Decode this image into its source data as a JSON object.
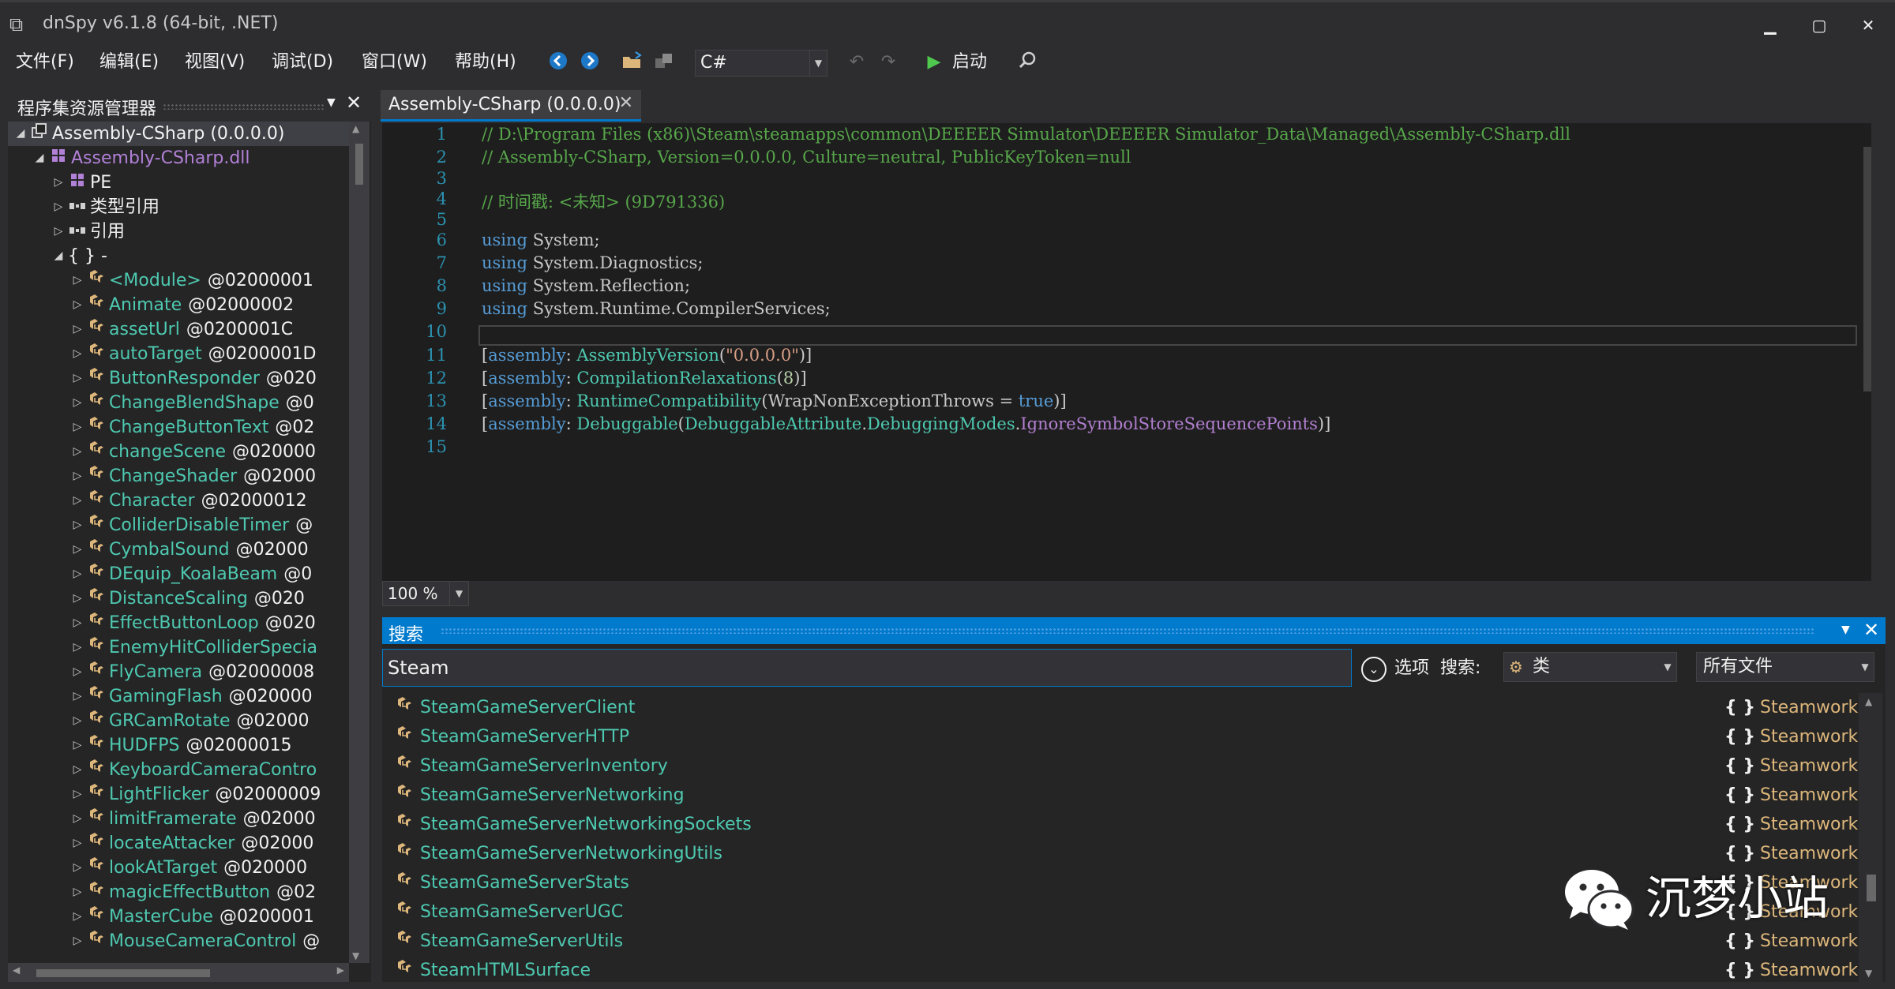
{
  "window": {
    "title": "dnSpy v6.1.8 (64-bit, .NET)",
    "minimize": "▁",
    "maximize": "▢",
    "close": "✕"
  },
  "menu": {
    "items": [
      "文件(F)",
      "编辑(E)",
      "视图(V)",
      "调试(D)",
      "窗口(W)",
      "帮助(H)"
    ]
  },
  "toolbar": {
    "language": "C#",
    "start_label": "启动"
  },
  "explorer": {
    "title": "程序集资源管理器",
    "root": "Assembly-CSharp (0.0.0.0)",
    "module": "Assembly-CSharp.dll",
    "children": [
      "PE",
      "类型引用",
      "引用",
      "{ } -"
    ],
    "types": [
      {
        "name": "<Module>",
        "token": "@02000001"
      },
      {
        "name": "Animate",
        "token": "@02000002"
      },
      {
        "name": "assetUrl",
        "token": "@0200001C"
      },
      {
        "name": "autoTarget",
        "token": "@0200001D"
      },
      {
        "name": "ButtonResponder",
        "token": "@020"
      },
      {
        "name": "ChangeBlendShape",
        "token": "@0"
      },
      {
        "name": "ChangeButtonText",
        "token": "@02"
      },
      {
        "name": "changeScene",
        "token": "@020000"
      },
      {
        "name": "ChangeShader",
        "token": "@02000"
      },
      {
        "name": "Character",
        "token": "@02000012"
      },
      {
        "name": "ColliderDisableTimer",
        "token": "@"
      },
      {
        "name": "CymbalSound",
        "token": "@02000"
      },
      {
        "name": "DEquip_KoalaBeam",
        "token": "@0"
      },
      {
        "name": "DistanceScaling",
        "token": "@020"
      },
      {
        "name": "EffectButtonLoop",
        "token": "@020"
      },
      {
        "name": "EnemyHitColliderSpecia",
        "token": ""
      },
      {
        "name": "FlyCamera",
        "token": "@02000008"
      },
      {
        "name": "GamingFlash",
        "token": "@020000"
      },
      {
        "name": "GRCamRotate",
        "token": "@02000"
      },
      {
        "name": "HUDFPS",
        "token": "@02000015"
      },
      {
        "name": "KeyboardCameraContro",
        "token": ""
      },
      {
        "name": "LightFlicker",
        "token": "@02000009"
      },
      {
        "name": "limitFramerate",
        "token": "@02000"
      },
      {
        "name": "locateAttacker",
        "token": "@02000"
      },
      {
        "name": "lookAtTarget",
        "token": "@020000"
      },
      {
        "name": "magicEffectButton",
        "token": "@02"
      },
      {
        "name": "MasterCube",
        "token": "@0200001"
      },
      {
        "name": "MouseCameraControl",
        "token": "@"
      }
    ]
  },
  "editor": {
    "tab_title": "Assembly-CSharp (0.0.0.0)",
    "zoom": "100 %",
    "line_numbers": [
      "1",
      "2",
      "3",
      "4",
      "5",
      "6",
      "7",
      "8",
      "9",
      "10",
      "11",
      "12",
      "13",
      "14",
      "15"
    ],
    "comment1": "// D:\\Program Files (x86)\\Steam\\steamapps\\common\\DEEEER Simulator\\DEEEER Simulator_Data\\Managed\\Assembly-CSharp.dll",
    "comment2": "// Assembly-CSharp, Version=0.0.0.0, Culture=neutral, PublicKeyToken=null",
    "comment4": "// 时间戳: <未知> (9D791336)",
    "kw_using": "using",
    "ns1": "System",
    "ns2a": "System",
    "ns2b": "Diagnostics",
    "ns3a": "System",
    "ns3b": "Reflection",
    "ns4a": "System",
    "ns4b": "Runtime",
    "ns4c": "CompilerServices",
    "kw_assembly": "assembly",
    "attr1": "AssemblyVersion",
    "attr1_arg": "\"0.0.0.0\"",
    "attr2": "CompilationRelaxations",
    "attr2_arg": "8",
    "attr3": "RuntimeCompatibility",
    "attr3_prop": "WrapNonExceptionThrows",
    "attr3_val": "true",
    "attr4": "Debuggable",
    "attr4_type": "DebuggableAttribute",
    "attr4_enum": "DebuggingModes",
    "attr4_member": "IgnoreSymbolStoreSequencePoints"
  },
  "search": {
    "title": "搜索",
    "query": "Steam",
    "options_label": "选项",
    "search_label": "搜索:",
    "type_value": "类",
    "scope_value": "所有文件",
    "results": [
      {
        "name": "SteamGameServerClient",
        "ns": "Steamworks"
      },
      {
        "name": "SteamGameServerHTTP",
        "ns": "Steamworks"
      },
      {
        "name": "SteamGameServerInventory",
        "ns": "Steamworks"
      },
      {
        "name": "SteamGameServerNetworking",
        "ns": "Steamworks"
      },
      {
        "name": "SteamGameServerNetworkingSockets",
        "ns": "Steamworks"
      },
      {
        "name": "SteamGameServerNetworkingUtils",
        "ns": "Steamworks"
      },
      {
        "name": "SteamGameServerStats",
        "ns": "Steamworks"
      },
      {
        "name": "SteamGameServerUGC",
        "ns": "Steamworks"
      },
      {
        "name": "SteamGameServerUtils",
        "ns": "Steamworks"
      },
      {
        "name": "SteamHTMLSurface",
        "ns": "Steamworks"
      }
    ]
  },
  "watermark": {
    "text": "沉梦小站"
  },
  "colors": {
    "accent": "#007acc",
    "type": "#4ec9b0",
    "comment": "#57a64a",
    "keyword": "#569cd6"
  }
}
